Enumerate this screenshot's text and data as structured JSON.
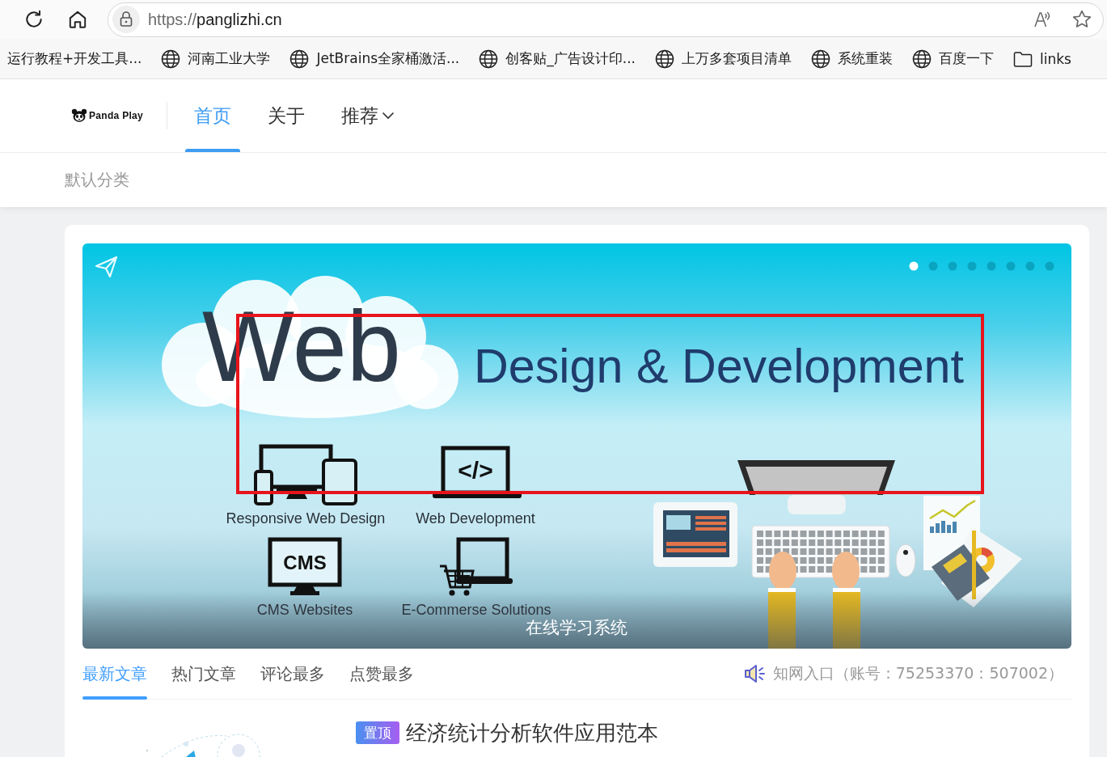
{
  "browser": {
    "address": {
      "scheme": "https://",
      "host": "panglizhi.cn"
    },
    "bookmarks": [
      {
        "kind": "plain",
        "label": "运行教程+开发工具..."
      },
      {
        "kind": "site",
        "label": "河南工业大学"
      },
      {
        "kind": "site",
        "label": "JetBrains全家桶激活..."
      },
      {
        "kind": "site",
        "label": "创客贴_广告设计印..."
      },
      {
        "kind": "site",
        "label": "上万多套项目清单"
      },
      {
        "kind": "site",
        "label": "系统重装"
      },
      {
        "kind": "site",
        "label": "百度一下"
      },
      {
        "kind": "folder",
        "label": "links"
      }
    ]
  },
  "site_nav": {
    "logo": "Panda Play",
    "items": [
      {
        "label": "首页",
        "selected": true,
        "dropdown": false
      },
      {
        "label": "关于",
        "selected": false,
        "dropdown": false
      },
      {
        "label": "推荐",
        "selected": false,
        "dropdown": true
      }
    ]
  },
  "category_bar": {
    "items": [
      {
        "label": "默认分类"
      }
    ]
  },
  "carousel": {
    "banner": {
      "heading": "Web",
      "subheading": "Design & Development",
      "features": [
        {
          "kind": "devices",
          "label": "Responsive Web Design"
        },
        {
          "kind": "code",
          "label": "Web Development",
          "screen_text": "</>"
        },
        {
          "kind": "cms",
          "label": "CMS Websites",
          "screen_text": "CMS"
        },
        {
          "kind": "cart",
          "label": "E-Commerse Solutions"
        }
      ]
    },
    "caption": "在线学习系统",
    "dots": [
      {
        "selected": true
      },
      {
        "selected": false
      },
      {
        "selected": false
      },
      {
        "selected": false
      },
      {
        "selected": false
      },
      {
        "selected": false
      },
      {
        "selected": false
      },
      {
        "selected": false
      }
    ]
  },
  "article_tabs": {
    "tabs": [
      {
        "label": "最新文章",
        "selected": true
      },
      {
        "label": "热门文章",
        "selected": false
      },
      {
        "label": "评论最多",
        "selected": false
      },
      {
        "label": "点赞最多",
        "selected": false
      }
    ],
    "notice": "知网入口（账号：75253370：507002）"
  },
  "posts": [
    {
      "badge": "置顶",
      "title": "经济统计分析软件应用范本"
    }
  ]
}
